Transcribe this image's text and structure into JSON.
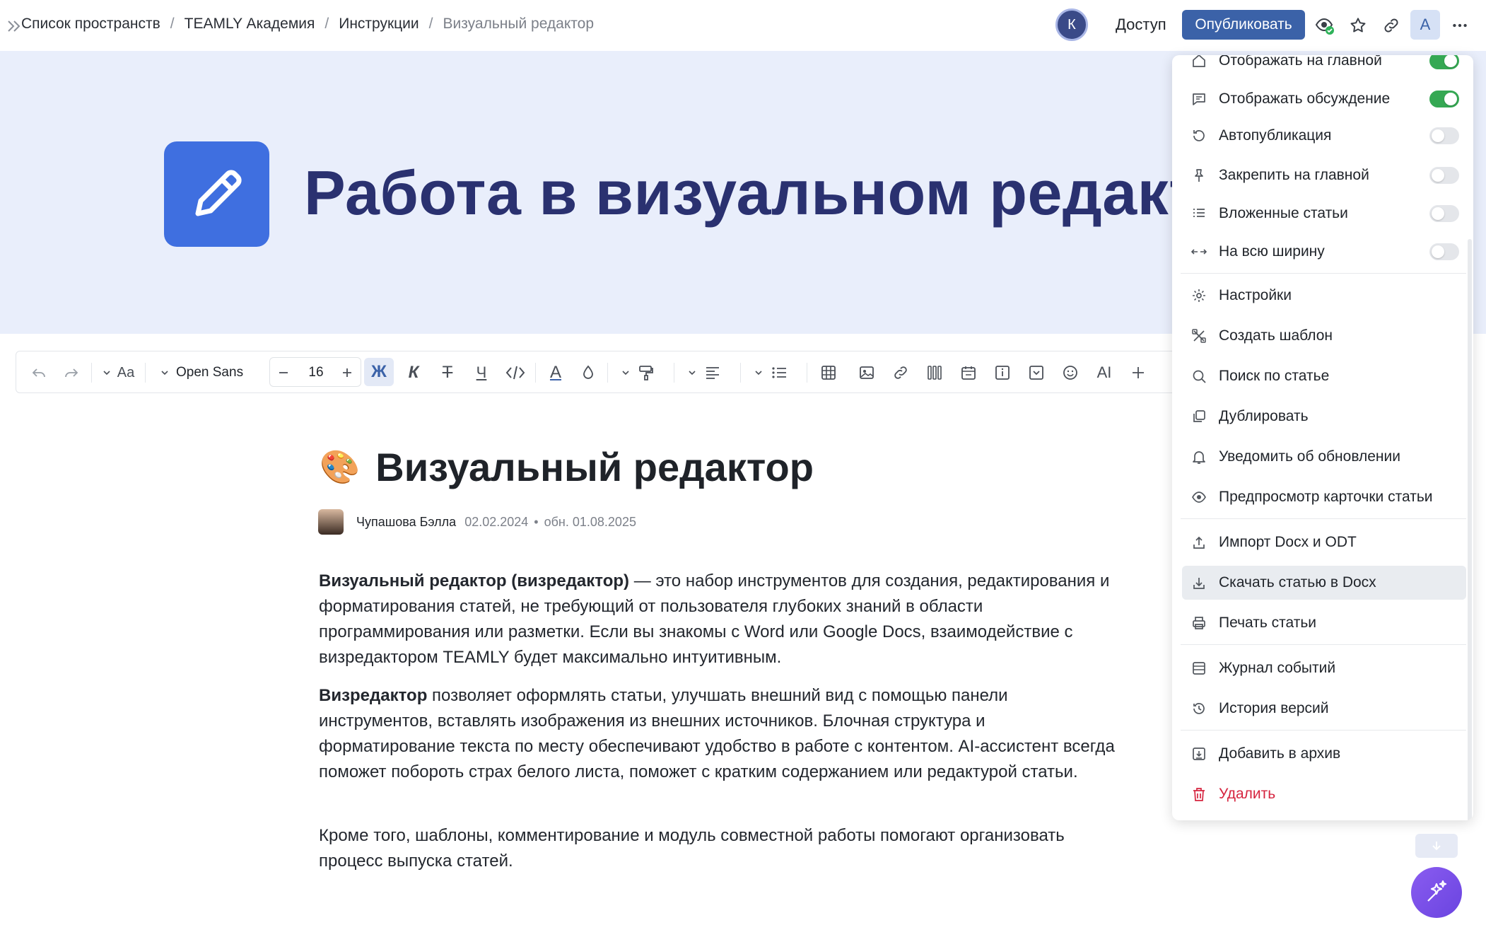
{
  "breadcrumb": {
    "items": [
      "Список пространств",
      "TEAMLY Академия",
      "Инструкции"
    ],
    "separator": "/",
    "current": "Визуальный редактор"
  },
  "header": {
    "user_initial": "К",
    "access_label": "Доступ",
    "publish_label": "Опубликовать",
    "profile_initial": "А",
    "icons": [
      "visibility-icon",
      "star-icon",
      "link-icon",
      "more-icon"
    ]
  },
  "cover": {
    "title": "Работа в визуальном редакт"
  },
  "toolbar": {
    "font_family": "Open Sans",
    "font_size": "16",
    "text_style_label": "Aa",
    "bold_label": "Ж",
    "italic_label": "К",
    "strike_label": "Т",
    "underline_label": "Ч",
    "text_color_label": "А",
    "ai_label": "AI"
  },
  "article": {
    "emoji": "🎨",
    "title": "Визуальный редактор",
    "author": "Чупашова Бэлла",
    "created": "02.02.2024",
    "dot": "•",
    "updated": "обн. 01.08.2025",
    "p1_bold": "Визуальный редактор (визредактор)",
    "p1_rest": " — это набор инструментов для создания, редактирования и форматирования статей, не требующий от пользователя глубоких знаний в области программирования или разметки. Если вы знакомы с Word или Google Docs, взаимодействие с визредактором TEAMLY будет максимально интуитивным.",
    "p2_bold": "Визредактор",
    "p2_rest": " позволяет оформлять статьи, улучшать внешний вид с помощью панели инструментов, вставлять изображения из внешних источников. Блочная структура и форматирование текста по месту обеспечивают удобство в работе с контентом. AI-ассистент всегда поможет побороть страх белого листа, поможет с кратким содержанием или редактурой статьи.",
    "p3": "Кроме того, шаблоны, комментирование и модуль совместной работы помогают организовать процесс выпуска статей."
  },
  "menu": {
    "toggles": [
      {
        "label": "Отображать на главной",
        "on": true
      },
      {
        "label": "Отображать обсуждение",
        "on": true
      },
      {
        "label": "Автопубликация",
        "on": false
      },
      {
        "label": "Закрепить на главной",
        "on": false
      },
      {
        "label": "Вложенные статьи",
        "on": false
      },
      {
        "label": "На всю ширину",
        "on": false
      }
    ],
    "items": {
      "settings": "Настройки",
      "create_template": "Создать шаблон",
      "search_article": "Поиск по статье",
      "duplicate": "Дублировать",
      "notify": "Уведомить об обновлении",
      "preview_card": "Предпросмотр карточки статьи",
      "import": "Импорт Docx и ODT",
      "download": "Скачать статью в Docx",
      "print": "Печать статьи",
      "event_log": "Журнал событий",
      "version_history": "История версий",
      "archive": "Добавить в архив",
      "delete": "Удалить"
    }
  },
  "colors": {
    "primary": "#3b62a8",
    "cover_bg": "#e9eefb",
    "cover_title": "#2a3170",
    "cover_icon": "#3f6fe0",
    "toggle_on": "#35a853",
    "danger": "#d6243f",
    "ai_fab": "#7b50e8"
  }
}
